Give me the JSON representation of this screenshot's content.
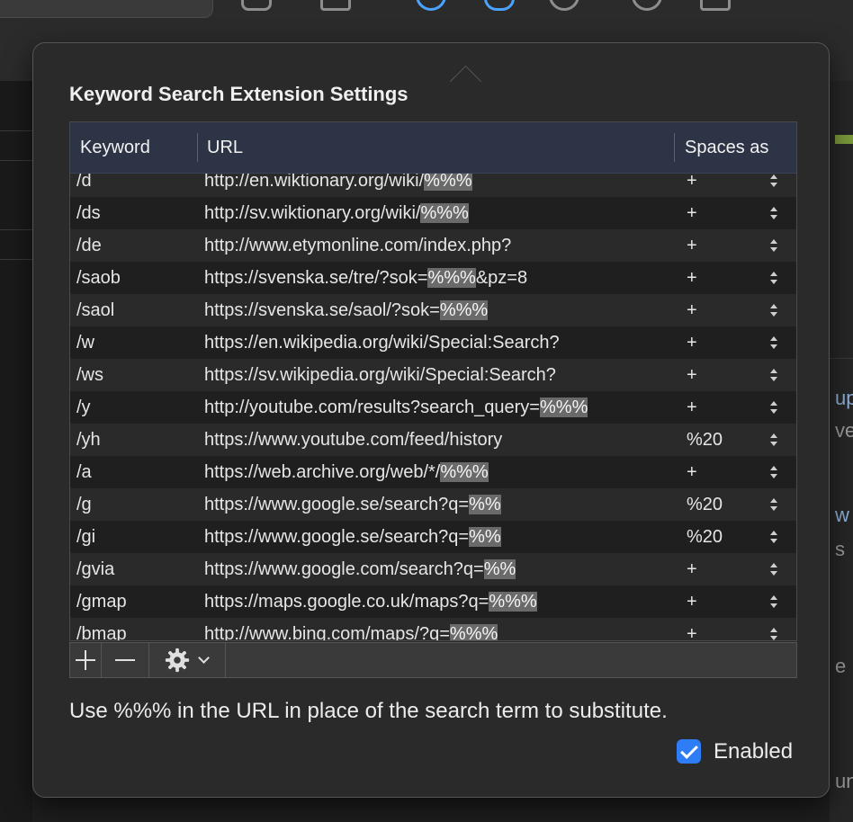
{
  "popover": {
    "title": "Keyword Search Extension Settings",
    "note": "Use %%% in the URL in place of the search term to substitute.",
    "enabled_label": "Enabled",
    "enabled": true
  },
  "table": {
    "headers": {
      "keyword": "Keyword",
      "url": "URL",
      "spaces": "Spaces as"
    },
    "rows": [
      {
        "keyword": "/d",
        "url_pre": "http://en.wiktionary.org/wiki/",
        "url_token": "%%%",
        "url_post": "",
        "spaces": "+"
      },
      {
        "keyword": "/ds",
        "url_pre": "http://sv.wiktionary.org/wiki/",
        "url_token": "%%%",
        "url_post": "",
        "spaces": "+"
      },
      {
        "keyword": "/de",
        "url_pre": "http://www.etymonline.com/index.php?",
        "url_token": "",
        "url_post": "",
        "spaces": "+"
      },
      {
        "keyword": "/saob",
        "url_pre": "https://svenska.se/tre/?sok=",
        "url_token": "%%%",
        "url_post": "&pz=8",
        "spaces": "+"
      },
      {
        "keyword": "/saol",
        "url_pre": "https://svenska.se/saol/?sok=",
        "url_token": "%%%",
        "url_post": "",
        "spaces": "+"
      },
      {
        "keyword": "/w",
        "url_pre": "https://en.wikipedia.org/wiki/Special:Search?",
        "url_token": "",
        "url_post": "",
        "spaces": "+"
      },
      {
        "keyword": "/ws",
        "url_pre": "https://sv.wikipedia.org/wiki/Special:Search?",
        "url_token": "",
        "url_post": "",
        "spaces": "+"
      },
      {
        "keyword": "/y",
        "url_pre": "http://youtube.com/results?search_query=",
        "url_token": "%%%",
        "url_post": "",
        "spaces": "+"
      },
      {
        "keyword": "/yh",
        "url_pre": "https://www.youtube.com/feed/history",
        "url_token": "",
        "url_post": "",
        "spaces": "%20"
      },
      {
        "keyword": "/a",
        "url_pre": "https://web.archive.org/web/*/",
        "url_token": "%%%",
        "url_post": "",
        "spaces": "+"
      },
      {
        "keyword": "/g",
        "url_pre": "https://www.google.se/search?q=",
        "url_token": "%%",
        "url_post": "",
        "spaces": "%20"
      },
      {
        "keyword": "/gi",
        "url_pre": "https://www.google.se/search?q=",
        "url_token": "%%",
        "url_post": "",
        "spaces": "%20"
      },
      {
        "keyword": "/gvia",
        "url_pre": "https://www.google.com/search?q=",
        "url_token": "%%",
        "url_post": "",
        "spaces": "+"
      },
      {
        "keyword": "/gmap",
        "url_pre": "https://maps.google.co.uk/maps?q=",
        "url_token": "%%%",
        "url_post": "",
        "spaces": "+"
      },
      {
        "keyword": "/bmap",
        "url_pre": "http://www.bing.com/maps/?q=",
        "url_token": "%%%",
        "url_post": "",
        "spaces": "+"
      }
    ]
  },
  "bottombar": {
    "add_icon": "plus-icon",
    "remove_icon": "minus-icon",
    "actions_icon": "gear-icon"
  },
  "background": {
    "right_fragments": [
      "up",
      "ve",
      "w",
      "s",
      "e",
      "un"
    ]
  },
  "colors": {
    "header_bg": "#2c3446",
    "checkbox_accent": "#2e7cf6",
    "token_highlight": "#6a6a6a"
  }
}
